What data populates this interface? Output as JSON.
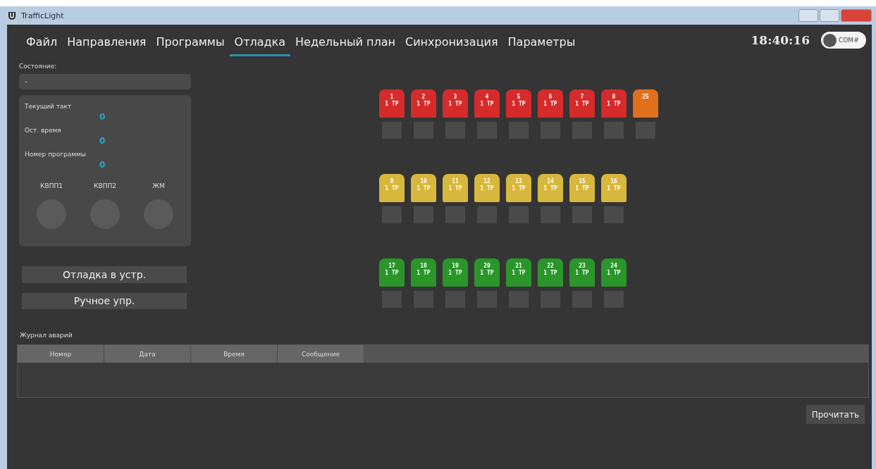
{
  "window": {
    "title": "TrafficLight"
  },
  "menu": [
    {
      "label": "Файл",
      "selected": false
    },
    {
      "label": "Направления",
      "selected": false
    },
    {
      "label": "Программы",
      "selected": false
    },
    {
      "label": "Отладка",
      "selected": true
    },
    {
      "label": "Недельный план",
      "selected": false
    },
    {
      "label": "Синхронизация",
      "selected": false
    },
    {
      "label": "Параметры",
      "selected": false
    }
  ],
  "clock": "18:40:16",
  "port_switch": {
    "label": "COM#",
    "on": false
  },
  "state": {
    "label": "Состояние:",
    "value": "-"
  },
  "status": [
    {
      "label": "Текущий такт",
      "value": "0"
    },
    {
      "label": "Ост. время",
      "value": "0"
    },
    {
      "label": "Номер программы",
      "value": "0"
    }
  ],
  "indicators": [
    {
      "label": "КВПП1",
      "on": false
    },
    {
      "label": "КВПП2",
      "on": false
    },
    {
      "label": "ЖМ",
      "on": false
    }
  ],
  "buttons": [
    "Отладка в устр.",
    "Ручное упр."
  ],
  "signal_rows": [
    [
      {
        "number": "1",
        "sub": "1 ТР",
        "color": "#d62b2b"
      },
      {
        "number": "2",
        "sub": "1 ТР",
        "color": "#d62b2b"
      },
      {
        "number": "3",
        "sub": "1 ТР",
        "color": "#d62b2b"
      },
      {
        "number": "4",
        "sub": "1 ТР",
        "color": "#d62b2b"
      },
      {
        "number": "5",
        "sub": "1 ТР",
        "color": "#d62b2b"
      },
      {
        "number": "6",
        "sub": "1 ТР",
        "color": "#d62b2b"
      },
      {
        "number": "7",
        "sub": "1 ТР",
        "color": "#d62b2b"
      },
      {
        "number": "8",
        "sub": "1 ТР",
        "color": "#d62b2b"
      },
      {
        "number": "25",
        "color": "#e0701c"
      }
    ],
    [
      {
        "number": "9",
        "sub": "1 ТР",
        "color": "#d8b83c"
      },
      {
        "number": "10",
        "sub": "1 ТР",
        "color": "#d8b83c"
      },
      {
        "number": "11",
        "sub": "1 ТР",
        "color": "#d8b83c"
      },
      {
        "number": "12",
        "sub": "1 ТР",
        "color": "#d8b83c"
      },
      {
        "number": "13",
        "sub": "1 ТР",
        "color": "#d8b83c"
      },
      {
        "number": "14",
        "sub": "1 ТР",
        "color": "#d8b83c"
      },
      {
        "number": "15",
        "sub": "1 ТР",
        "color": "#d8b83c"
      },
      {
        "number": "16",
        "sub": "1 ТР",
        "color": "#d8b83c"
      }
    ],
    [
      {
        "number": "17",
        "sub": "1 ТР",
        "color": "#2a962a"
      },
      {
        "number": "18",
        "sub": "1 ТР",
        "color": "#2a962a"
      },
      {
        "number": "19",
        "sub": "1 ТР",
        "color": "#2a962a"
      },
      {
        "number": "20",
        "sub": "1 ТР",
        "color": "#2a962a"
      },
      {
        "number": "21",
        "sub": "1 ТР",
        "color": "#2a962a"
      },
      {
        "number": "22",
        "sub": "1 ТР",
        "color": "#2a962a"
      },
      {
        "number": "23",
        "sub": "1 ТР",
        "color": "#2a962a"
      },
      {
        "number": "24",
        "sub": "1 ТР",
        "color": "#2a962a"
      }
    ]
  ],
  "journal": {
    "title": "Журнал аварий",
    "columns": [
      "Номер",
      "Дата",
      "Время",
      "Сообщение"
    ]
  },
  "read_button": "Прочитать"
}
